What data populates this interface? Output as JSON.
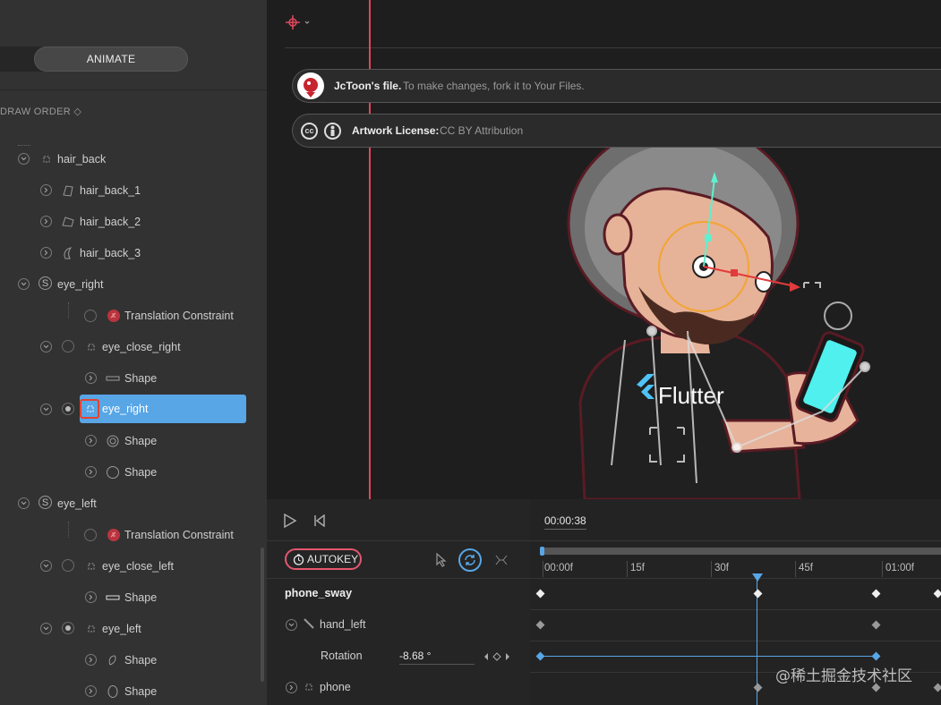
{
  "tabs": {
    "animate": "ANIMATE"
  },
  "draw_order": {
    "label": "DRAW ORDER"
  },
  "tree": [
    {
      "label": "hair_back"
    },
    {
      "label": "hair_back_1"
    },
    {
      "label": "hair_back_2"
    },
    {
      "label": "hair_back_3"
    },
    {
      "label": "eye_right"
    },
    {
      "label": "Translation Constraint"
    },
    {
      "label": "eye_close_right"
    },
    {
      "label": "Shape"
    },
    {
      "label": "eye_right"
    },
    {
      "label": "Shape"
    },
    {
      "label": "Shape"
    },
    {
      "label": "eye_left"
    },
    {
      "label": "Translation Constraint"
    },
    {
      "label": "eye_close_left"
    },
    {
      "label": "Shape"
    },
    {
      "label": "eye_left"
    },
    {
      "label": "Shape"
    },
    {
      "label": "Shape"
    }
  ],
  "banners": {
    "file_owner": "JcToon's file.",
    "file_msg": "To make changes, fork it to Your Files.",
    "license_title": "Artwork License:",
    "license_value": "CC BY Attribution",
    "cc": "cc"
  },
  "stage": {
    "brand": "Flutter"
  },
  "timeline": {
    "time": "00:00:38",
    "autokey": "AUTOKEY",
    "ticks": [
      "00:00f",
      "15f",
      "30f",
      "45f",
      "01:00f"
    ],
    "animation": "phone_sway",
    "tracks": {
      "hand_left": "hand_left",
      "rotation_label": "Rotation",
      "rotation_value": "-8.68 °",
      "phone": "phone"
    }
  },
  "watermark": "@稀土掘金技术社区",
  "colors": {
    "accent": "#58a6e6",
    "selection_outline": "#e4432f",
    "playhead": "#e0465b",
    "autokey": "#e4576f"
  }
}
